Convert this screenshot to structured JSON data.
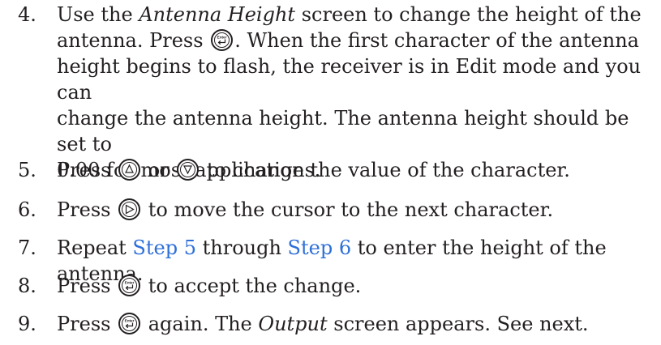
{
  "steps": [
    {
      "num": "4.",
      "lines": [
        [
          "Use the ",
          {
            "i": "Antenna Height"
          },
          " screen to change the height of the"
        ],
        [
          "antenna. Press ",
          {
            "icon": "enter"
          },
          ". When the first character of the antenna"
        ],
        [
          "height begins to flash, the receiver is in Edit mode and you can"
        ],
        [
          "change the antenna height. The antenna height should be set to"
        ],
        [
          "0.00 for most applications."
        ]
      ]
    },
    {
      "num": "5.",
      "lines": [
        [
          "Press ",
          {
            "icon": "up"
          },
          " or ",
          {
            "icon": "down"
          },
          " to change the value of the character."
        ]
      ]
    },
    {
      "num": "6.",
      "lines": [
        [
          "Press ",
          {
            "icon": "right"
          },
          " to move the cursor to the next character."
        ]
      ]
    },
    {
      "num": "7.",
      "lines": [
        [
          "Repeat ",
          {
            "link": "Step 5"
          },
          " through ",
          {
            "link": "Step 6"
          },
          " to enter the height of the antenna."
        ]
      ]
    },
    {
      "num": "8.",
      "lines": [
        [
          "Press ",
          {
            "icon": "enter"
          },
          " to accept the change."
        ]
      ]
    },
    {
      "num": "9.",
      "lines": [
        [
          "Press ",
          {
            "icon": "enter"
          },
          " again. The ",
          {
            "i": "Output"
          },
          " screen appears. See next."
        ]
      ]
    }
  ],
  "icons": {
    "enter": {
      "name": "enter-key-icon",
      "label": "Enter"
    },
    "up": {
      "name": "up-arrow-key-icon"
    },
    "down": {
      "name": "down-arrow-key-icon"
    },
    "right": {
      "name": "right-arrow-key-icon"
    }
  },
  "colors": {
    "text": "#231f20",
    "link": "#2e6fd8"
  }
}
